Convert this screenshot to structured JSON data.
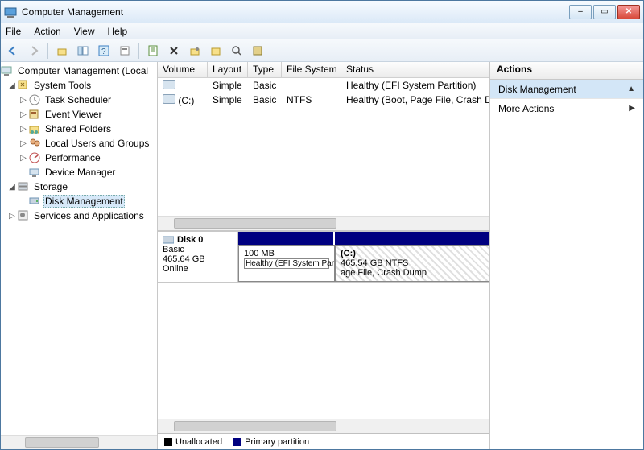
{
  "window": {
    "title": "Computer Management"
  },
  "menu": {
    "file": "File",
    "action": "Action",
    "view": "View",
    "help": "Help"
  },
  "tree": {
    "root": "Computer Management (Local",
    "systools": "System Tools",
    "task": "Task Scheduler",
    "event": "Event Viewer",
    "shared": "Shared Folders",
    "users": "Local Users and Groups",
    "perf": "Performance",
    "devmgr": "Device Manager",
    "storage": "Storage",
    "diskmgmt": "Disk Management",
    "services": "Services and Applications"
  },
  "grid": {
    "headers": {
      "volume": "Volume",
      "layout": "Layout",
      "type": "Type",
      "fs": "File System",
      "status": "Status"
    },
    "rows": [
      {
        "vol": "",
        "layout": "Simple",
        "type": "Basic",
        "fs": "",
        "status": "Healthy (EFI System Partition)"
      },
      {
        "vol": "(C:)",
        "layout": "Simple",
        "type": "Basic",
        "fs": "NTFS",
        "status": "Healthy (Boot, Page File, Crash Dum"
      }
    ]
  },
  "disk": {
    "name": "Disk 0",
    "type": "Basic",
    "size": "465.64 GB",
    "state": "Online",
    "parts": [
      {
        "size": "100 MB",
        "status": "Healthy (EFI System Partition)"
      },
      {
        "label": "(C:)",
        "size": "465.54 GB NTFS",
        "status": "age File, Crash Dump"
      }
    ]
  },
  "legend": {
    "unalloc": "Unallocated",
    "primary": "Primary partition"
  },
  "actions": {
    "title": "Actions",
    "diskmgmt": "Disk Management",
    "more": "More Actions"
  },
  "colors": {
    "navy": "#000080",
    "accentBlue": "#d3e6f7"
  }
}
